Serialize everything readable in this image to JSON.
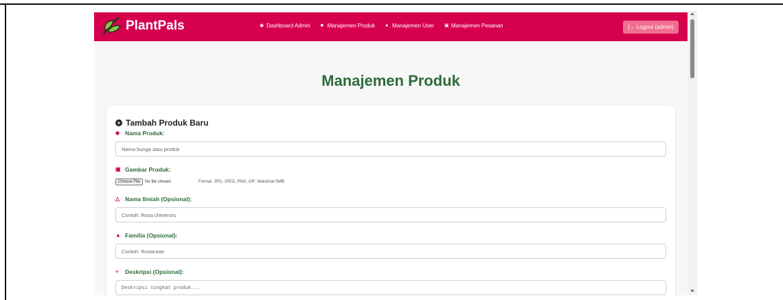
{
  "brand": {
    "name": "PlantPals",
    "icon": "leaf-icon"
  },
  "nav": {
    "links": [
      {
        "label": "Dashboard Admin",
        "icon": "dashboard-icon"
      },
      {
        "label": "Manajemen Produk",
        "icon": "box-icon"
      },
      {
        "label": "Manajemen User",
        "icon": "users-icon"
      },
      {
        "label": "Manajemen Pesanan",
        "icon": "receipt-icon"
      }
    ],
    "logout": "[→ Logout (admin)"
  },
  "page": {
    "title": "Manajemen Produk"
  },
  "form": {
    "title": "Tambah Produk Baru",
    "nama_label": "Nama Produk:",
    "nama_placeholder": "Nama bunga atau produk",
    "gambar_label": "Gambar Produk:",
    "choose_file": "Choose File",
    "no_file": "No file chosen",
    "file_hint": "Format: JPG, JPEG, PNG, GIF. Maksimal 5MB.",
    "ilmiah_label": "Nama Ilmiah (Opsional):",
    "ilmiah_placeholder": "Contoh: Rosa chinensis",
    "famili_label": "Familia (Opsional):",
    "famili_placeholder": "Contoh: Rosaceae",
    "deskripsi_label": "Deskripsi (Opsional):",
    "deskripsi_placeholder": "Deskripsi singkat produk..."
  },
  "colors": {
    "navbar": "#d6004f",
    "accent_green": "#2e6b3a",
    "logout": "#ef6f8f"
  }
}
